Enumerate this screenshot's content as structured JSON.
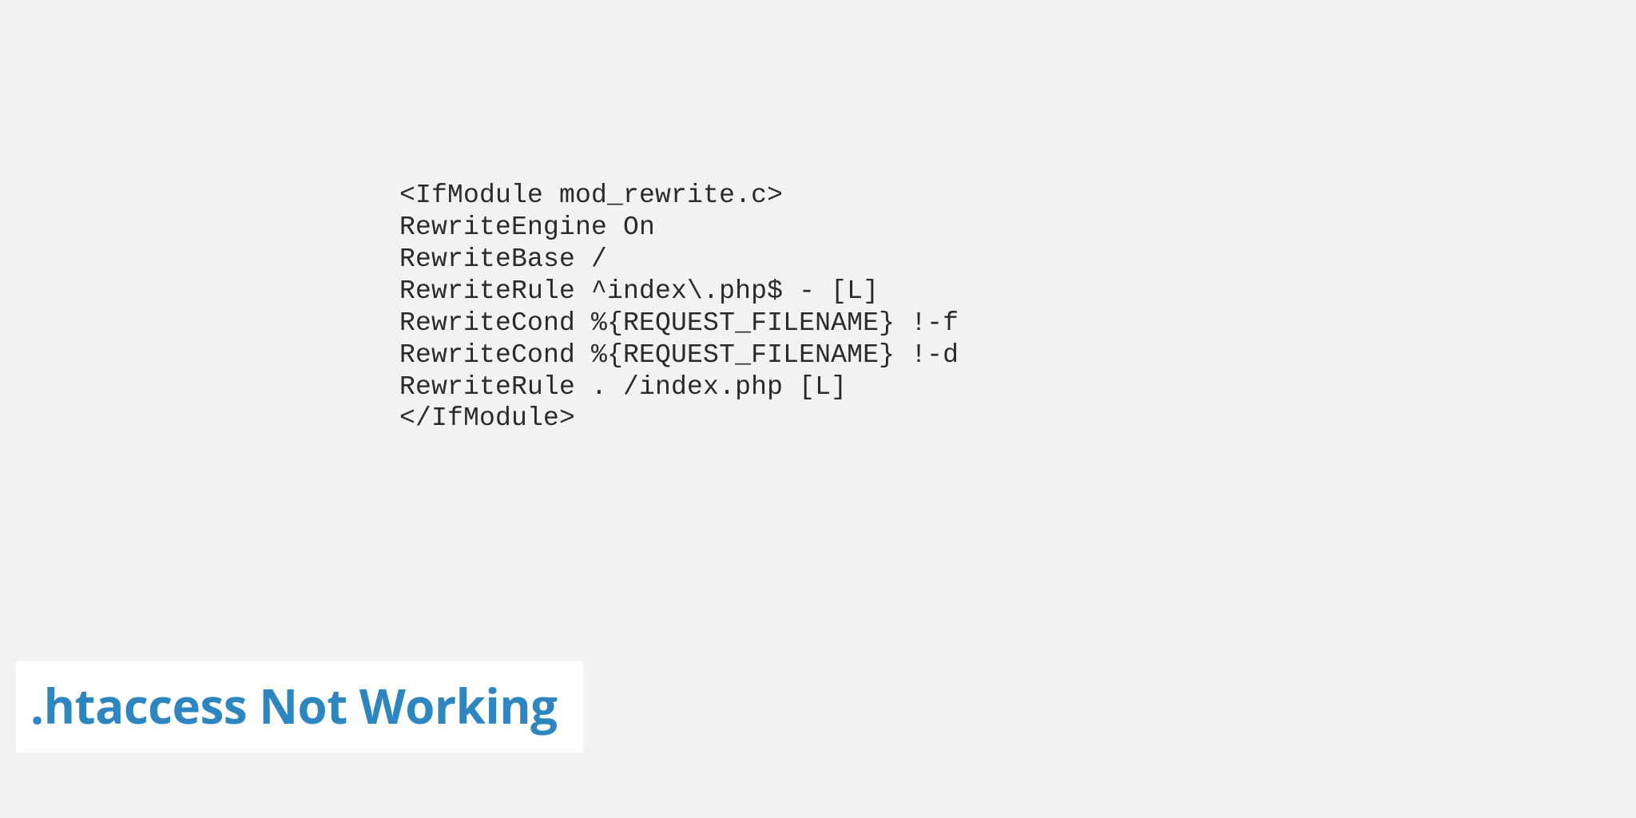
{
  "code": {
    "line1": "<IfModule mod_rewrite.c>",
    "line2": "RewriteEngine On",
    "line3": "RewriteBase /",
    "line4": "RewriteRule ^index\\.php$ - [L]",
    "line5": "RewriteCond %{REQUEST_FILENAME} !-f",
    "line6": "RewriteCond %{REQUEST_FILENAME} !-d",
    "line7": "RewriteRule . /index.php [L]",
    "line8": "</IfModule>"
  },
  "title": ".htaccess Not Working"
}
